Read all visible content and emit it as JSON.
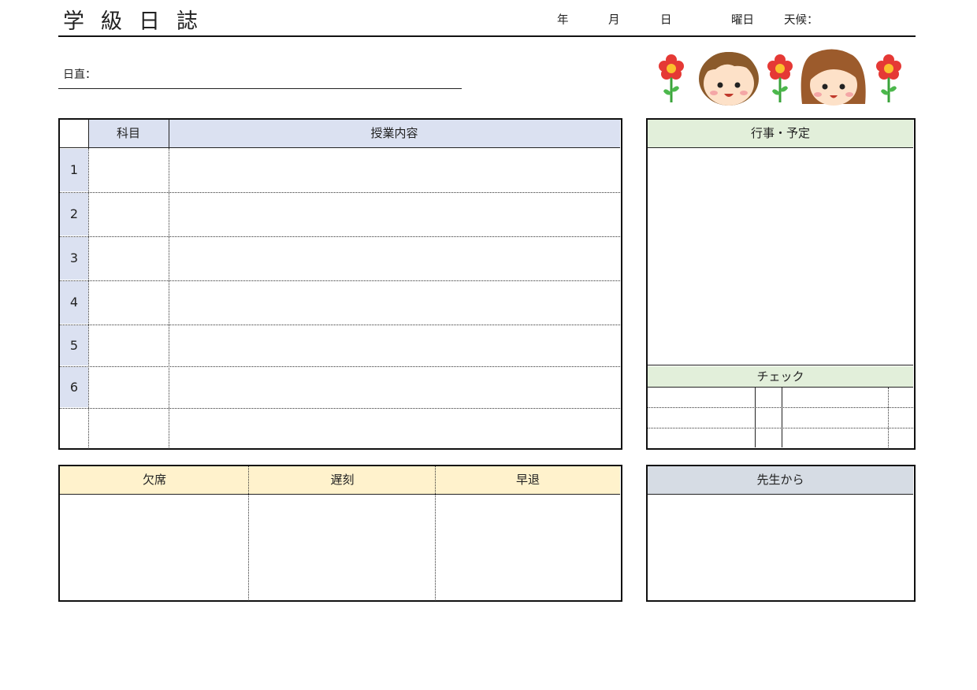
{
  "header": {
    "title": "学級日誌",
    "year_label": "年",
    "month_label": "月",
    "day_label": "日",
    "weekday_label": "曜日",
    "weather_label": "天候："
  },
  "duty": {
    "label": "日直："
  },
  "schedule_table": {
    "columns": [
      "",
      "科目",
      "授業内容"
    ],
    "periods": [
      "1",
      "2",
      "3",
      "4",
      "5",
      "6",
      ""
    ]
  },
  "events": {
    "title": "行事・予定"
  },
  "check": {
    "title": "チェック"
  },
  "attendance": {
    "columns": [
      "欠席",
      "遅刻",
      "早退"
    ]
  },
  "teacher": {
    "title": "先生から"
  },
  "colors": {
    "schedule_header": "#dbe1f1",
    "events_header": "#e2efda",
    "attendance_header": "#fff2cc",
    "teacher_header": "#d6dce4"
  },
  "decorations": [
    "flower-icon",
    "boy-face-icon",
    "flower-icon",
    "girl-face-icon",
    "flower-icon"
  ]
}
